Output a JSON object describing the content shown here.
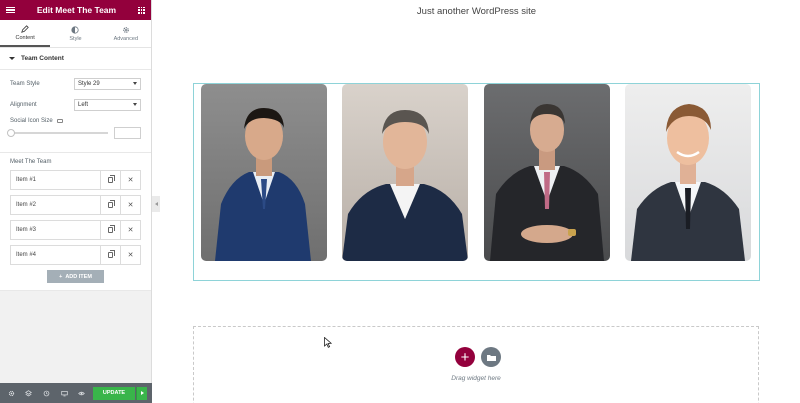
{
  "panel": {
    "title": "Edit Meet The Team",
    "tabs": [
      {
        "label": "Content",
        "icon": "pencil-icon",
        "active": true
      },
      {
        "label": "Style",
        "icon": "half-circle-icon",
        "active": false
      },
      {
        "label": "Advanced",
        "icon": "gear-icon",
        "active": false
      }
    ],
    "section_title": "Team Content",
    "team_style": {
      "label": "Team Style",
      "value": "Style 29"
    },
    "alignment": {
      "label": "Alignment",
      "value": "Left"
    },
    "social_icon_size": {
      "label": "Social Icon Size"
    },
    "repeater": {
      "title": "Meet The Team",
      "items": [
        "Item #1",
        "Item #2",
        "Item #3",
        "Item #4"
      ]
    },
    "add_item_label": "ADD ITEM",
    "footer": {
      "icons": [
        "settings-icon",
        "layers-icon",
        "history-icon",
        "responsive-icon",
        "preview-icon"
      ],
      "update_label": "UPDATE"
    }
  },
  "canvas": {
    "tagline": "Just another WordPress site",
    "drop_text": "Drag widget here"
  },
  "colors": {
    "brand": "#93003c",
    "update_green": "#39b54a",
    "section_outline": "#8ed3d8"
  }
}
